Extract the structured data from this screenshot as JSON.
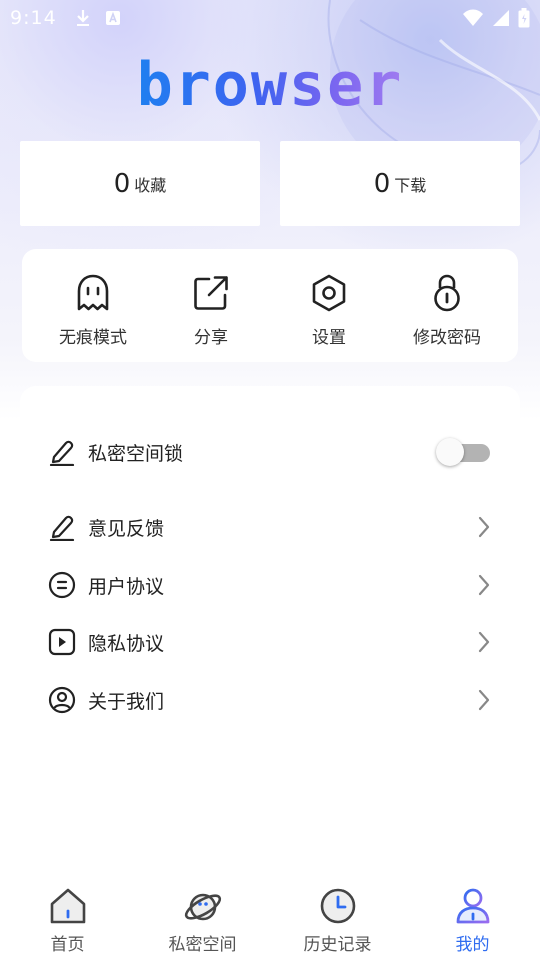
{
  "status_bar": {
    "time": "9:14",
    "icons": [
      "download-icon",
      "a-icon",
      "wifi-icon",
      "signal-icon",
      "battery-icon"
    ]
  },
  "brand": {
    "logo_text": "browser",
    "gradient": [
      "#1f7ff0",
      "#a07cf0"
    ]
  },
  "stats": [
    {
      "count": "0",
      "label": "收藏"
    },
    {
      "count": "0",
      "label": "下载"
    }
  ],
  "quick_actions": [
    {
      "label": "无痕模式",
      "icon": "ghost-icon"
    },
    {
      "label": "分享",
      "icon": "share-icon"
    },
    {
      "label": "设置",
      "icon": "settings-hexagon-icon"
    },
    {
      "label": "修改密码",
      "icon": "lock-icon"
    }
  ],
  "settings": {
    "private_lock": {
      "label": "私密空间锁",
      "icon": "pencil-icon",
      "enabled": false
    },
    "items": [
      {
        "label": "意见反馈",
        "icon": "pencil-icon"
      },
      {
        "label": "用户协议",
        "icon": "document-circle-icon"
      },
      {
        "label": "隐私协议",
        "icon": "play-square-icon"
      },
      {
        "label": "关于我们",
        "icon": "user-circle-icon"
      }
    ]
  },
  "tabbar": {
    "active": "我的",
    "active_color": "#2f6cf0",
    "tabs": [
      {
        "label": "首页",
        "icon": "home-icon"
      },
      {
        "label": "私密空间",
        "icon": "planet-icon"
      },
      {
        "label": "历史记录",
        "icon": "clock-icon"
      },
      {
        "label": "我的",
        "icon": "profile-icon"
      }
    ]
  }
}
